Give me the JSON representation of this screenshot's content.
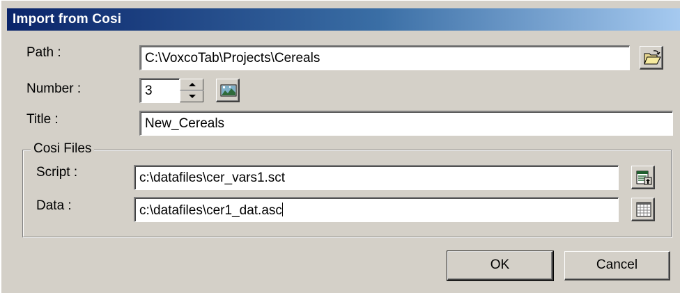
{
  "window": {
    "title": "Import from Cosi"
  },
  "form": {
    "path_label": "Path :",
    "path_value": "C:\\VoxcoTab\\Projects\\Cereals",
    "number_label": "Number :",
    "number_value": "3",
    "title_label": "Title :",
    "title_value": "New_Cereals"
  },
  "cosi_files": {
    "group_label": "Cosi Files",
    "script_label": "Script :",
    "script_value": "c:\\datafiles\\cer_vars1.sct",
    "data_label": "Data :",
    "data_value": "c:\\datafiles\\cer1_dat.asc"
  },
  "buttons": {
    "ok_label": "OK",
    "cancel_label": "Cancel"
  },
  "icons": {
    "browse_path": "open-folder-icon",
    "number_action": "chart-image-icon",
    "script_browse": "script-file-icon",
    "data_browse": "data-grid-icon"
  },
  "colors": {
    "dialog_face": "#d4d0c8",
    "title_bar_start": "#0a246a",
    "title_bar_end": "#a6caf0",
    "title_text": "#ffffff"
  }
}
